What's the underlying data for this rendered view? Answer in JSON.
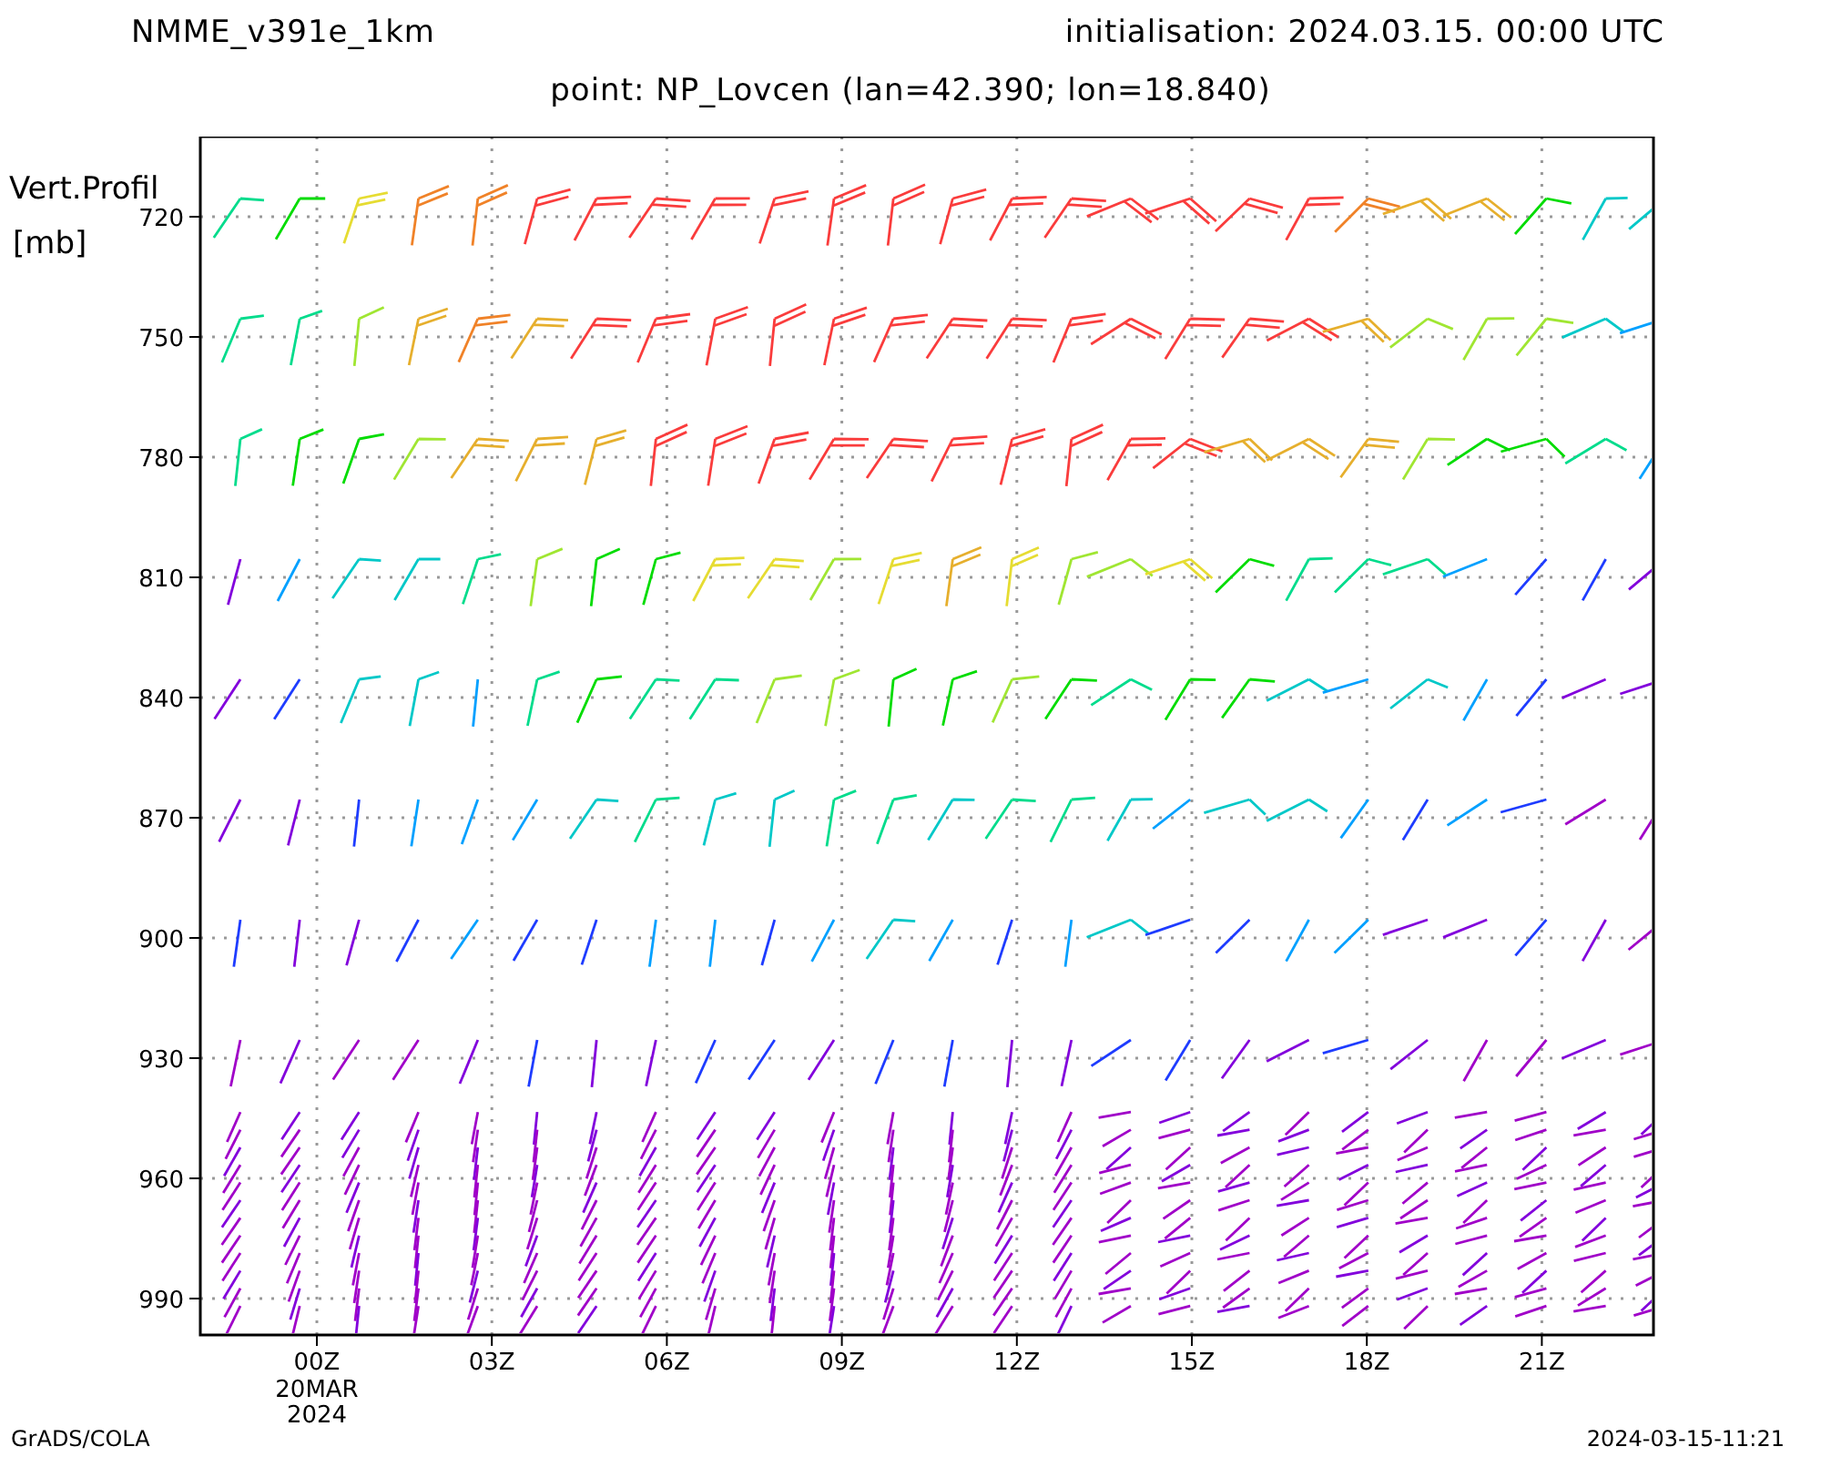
{
  "header": {
    "model": "NMME_v391e_1km",
    "initialisation": "initialisation: 2024.03.15. 00:00 UTC"
  },
  "title": "point: NP_Lovcen (lan=42.390; lon=18.840)",
  "y_axis": {
    "label": "Vert.Profil",
    "unit": "[mb]",
    "ticks": [
      "720",
      "750",
      "780",
      "810",
      "840",
      "870",
      "900",
      "930",
      "960",
      "990"
    ]
  },
  "x_axis": {
    "ticks": [
      {
        "label": "00Z",
        "extra": [
          "20MAR",
          "2024"
        ]
      },
      {
        "label": "03Z"
      },
      {
        "label": "06Z"
      },
      {
        "label": "09Z"
      },
      {
        "label": "12Z"
      },
      {
        "label": "15Z"
      },
      {
        "label": "18Z"
      },
      {
        "label": "21Z"
      }
    ]
  },
  "footer": {
    "left": "GrADS/COLA",
    "right": "2024-03-15-11:21"
  }
}
